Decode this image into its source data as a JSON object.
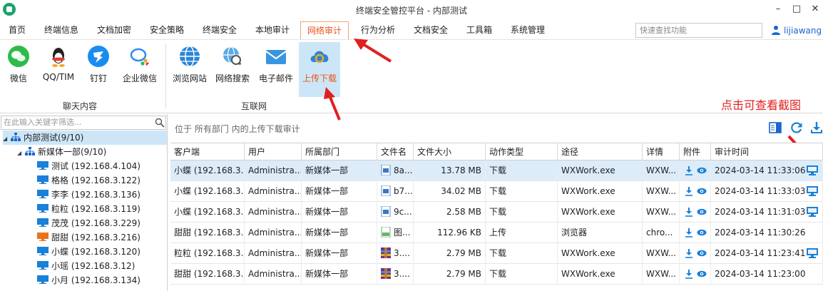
{
  "window": {
    "title": "终端安全管控平台 - 内部测试"
  },
  "menu": {
    "items": [
      "首页",
      "终端信息",
      "文档加密",
      "安全策略",
      "终端安全",
      "本地审计",
      "网络审计",
      "行为分析",
      "文档安全",
      "工具箱",
      "系统管理"
    ],
    "active_index": 6,
    "search_placeholder": "快速查找功能",
    "user": "lijiawang"
  },
  "ribbon": {
    "groups": [
      {
        "label": "聊天内容",
        "buttons": [
          "微信",
          "QQ/TIM",
          "钉钉",
          "企业微信"
        ]
      },
      {
        "label": "互联网",
        "buttons": [
          "浏览网站",
          "网络搜索",
          "电子邮件",
          "上传下载"
        ]
      }
    ],
    "selected": "上传下载"
  },
  "annotation": {
    "text": "点击可查看截图",
    "color": "#e02020"
  },
  "tree": {
    "search_placeholder": "在此输入关键字筛选...",
    "root": "内部测试(9/10)",
    "group": "新媒体一部(9/10)",
    "computers": [
      {
        "name": "测试 (192.168.4.104)",
        "status": "online"
      },
      {
        "name": "格格 (192.168.3.122)",
        "status": "online"
      },
      {
        "name": "李李 (192.168.3.136)",
        "status": "online"
      },
      {
        "name": "粒粒 (192.168.3.119)",
        "status": "online"
      },
      {
        "name": "茂茂 (192.168.3.229)",
        "status": "online"
      },
      {
        "name": "甜甜 (192.168.3.216)",
        "status": "offline"
      },
      {
        "name": "小蝶 (192.168.3.120)",
        "status": "online"
      },
      {
        "name": "小瑶 (192.168.3.12)",
        "status": "online"
      },
      {
        "name": "小月 (192.168.3.134)",
        "status": "online"
      }
    ]
  },
  "content": {
    "breadcrumb": "位于 所有部门 内的上传下载审计",
    "columns": [
      "客户端",
      "用户",
      "所属部门",
      "文件名",
      "文件大小",
      "动作类型",
      "途径",
      "详情",
      "附件",
      "审计时间"
    ],
    "rows": [
      {
        "client": "小蝶 (192.168.3...",
        "user": "Administra...",
        "dept": "新媒体一部",
        "file": "8a...",
        "ftype": "doc",
        "size": "13.78 MB",
        "action": "下载",
        "via": "WXWork.exe",
        "detail": "WXW...",
        "time": "2024-03-14 11:33:06",
        "screenshot": true
      },
      {
        "client": "小蝶 (192.168.3...",
        "user": "Administra...",
        "dept": "新媒体一部",
        "file": "b7...",
        "ftype": "doc",
        "size": "34.02 MB",
        "action": "下载",
        "via": "WXWork.exe",
        "detail": "WXW...",
        "time": "2024-03-14 11:33:03",
        "screenshot": true
      },
      {
        "client": "小蝶 (192.168.3...",
        "user": "Administra...",
        "dept": "新媒体一部",
        "file": "9c...",
        "ftype": "doc",
        "size": "2.58 MB",
        "action": "下载",
        "via": "WXWork.exe",
        "detail": "WXW...",
        "time": "2024-03-14 11:31:03",
        "screenshot": true
      },
      {
        "client": "甜甜 (192.168.3...",
        "user": "Administra...",
        "dept": "新媒体一部",
        "file": "图...",
        "ftype": "img",
        "size": "112.96 KB",
        "action": "上传",
        "via": "浏览器",
        "detail": "chro...",
        "time": "2024-03-14 11:30:26",
        "screenshot": false
      },
      {
        "client": "粒粒 (192.168.3...",
        "user": "Administra...",
        "dept": "新媒体一部",
        "file": "3....",
        "ftype": "rar",
        "size": "2.79 MB",
        "action": "下载",
        "via": "WXWork.exe",
        "detail": "WXW...",
        "time": "2024-03-14 11:23:41",
        "screenshot": true
      },
      {
        "client": "甜甜 (192.168.3...",
        "user": "Administra...",
        "dept": "新媒体一部",
        "file": "3....",
        "ftype": "rar",
        "size": "2.79 MB",
        "action": "下载",
        "via": "WXWork.exe",
        "detail": "WXW...",
        "time": "2024-03-14 11:23:00",
        "screenshot": false
      }
    ]
  }
}
